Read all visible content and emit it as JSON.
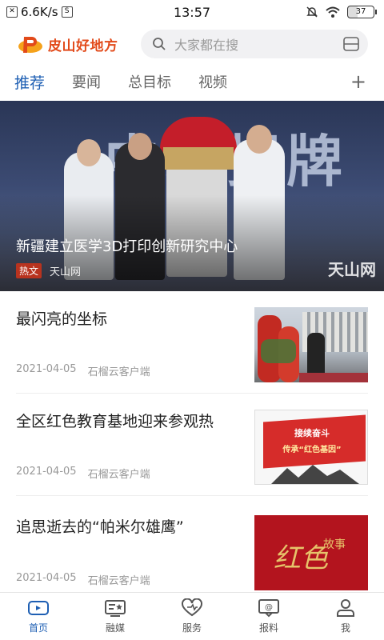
{
  "status_bar": {
    "net_speed": "6.6K/s",
    "time": "13:57",
    "battery": "37"
  },
  "header": {
    "logo_text": "皮山好地方",
    "search_placeholder": "大家都在搜"
  },
  "tabs": [
    {
      "label": "推荐",
      "active": true
    },
    {
      "label": "要闻",
      "active": false
    },
    {
      "label": "总目标",
      "active": false
    },
    {
      "label": "视频",
      "active": false
    }
  ],
  "tab_add": "+",
  "hero": {
    "title": "新疆建立医学3D打印创新研究中心",
    "tag": "热文",
    "source": "天山网",
    "bg_text": "中心揭牌",
    "watermark": "天山网"
  },
  "news": [
    {
      "title": "最闪亮的坐标",
      "date": "2021-04-05",
      "source": "石榴云客户端",
      "thumb": "wreath-photo"
    },
    {
      "title": "全区红色教育基地迎来参观热",
      "date": "2021-04-05",
      "source": "石榴云客户端",
      "thumb": "red-flag",
      "thumb_line1": "接续奋斗",
      "thumb_line2": "传承“红色基因”"
    },
    {
      "title": "追思逝去的“帕米尔雄鹰”",
      "date": "2021-04-05",
      "source": "石榴云客户端",
      "thumb": "red-story",
      "thumb_text": "红色",
      "thumb_text2": "故事"
    }
  ],
  "bottom_nav": [
    {
      "label": "首页",
      "icon": "video-home-icon",
      "active": true
    },
    {
      "label": "融媒",
      "icon": "media-card-icon",
      "active": false
    },
    {
      "label": "服务",
      "icon": "heart-service-icon",
      "active": false
    },
    {
      "label": "报料",
      "icon": "report-chat-icon",
      "active": false
    },
    {
      "label": "我",
      "icon": "user-icon",
      "active": false
    }
  ],
  "colors": {
    "accent": "#1e5fb3",
    "logo": "#e24a1a",
    "hot_tag": "#b8331f"
  }
}
